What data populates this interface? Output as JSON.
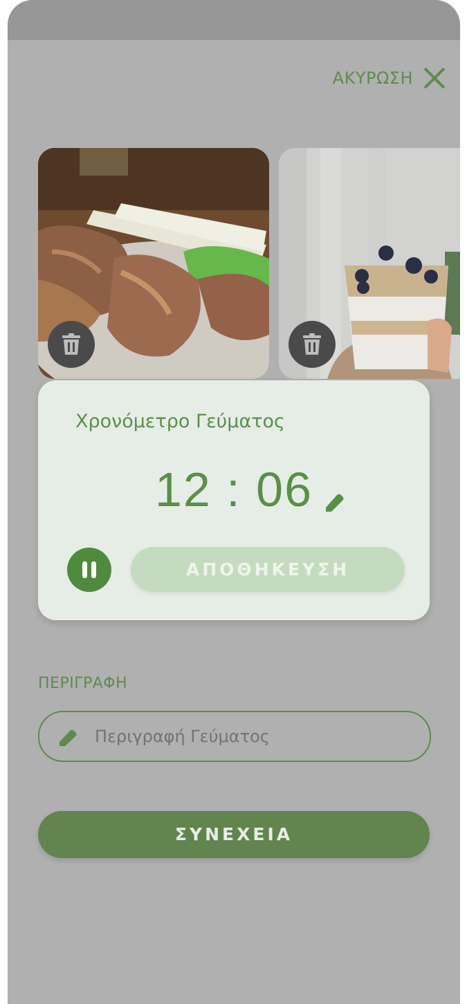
{
  "header": {
    "cancel_label": "ΑΚΥΡΩΣΗ"
  },
  "photos": [
    {
      "name": "meat-and-greens-plate"
    },
    {
      "name": "yogurt-granola-blueberries"
    }
  ],
  "timer": {
    "title": "Χρονόμετρο Γεύματος",
    "value": "12 : 06",
    "save_label": "ΑΠΟΘΗΚΕΥΣΗ"
  },
  "description": {
    "label": "ΠΕΡΙΓΡΑΦΗ",
    "placeholder": "Περιγραφή Γεύματος"
  },
  "continue_label": "ΣΥΝΕΧΕΙΑ",
  "colors": {
    "accent": "#5e8a4e",
    "overlay": "#b0b0b0",
    "card": "#e6ede6",
    "continue": "#62844f"
  }
}
